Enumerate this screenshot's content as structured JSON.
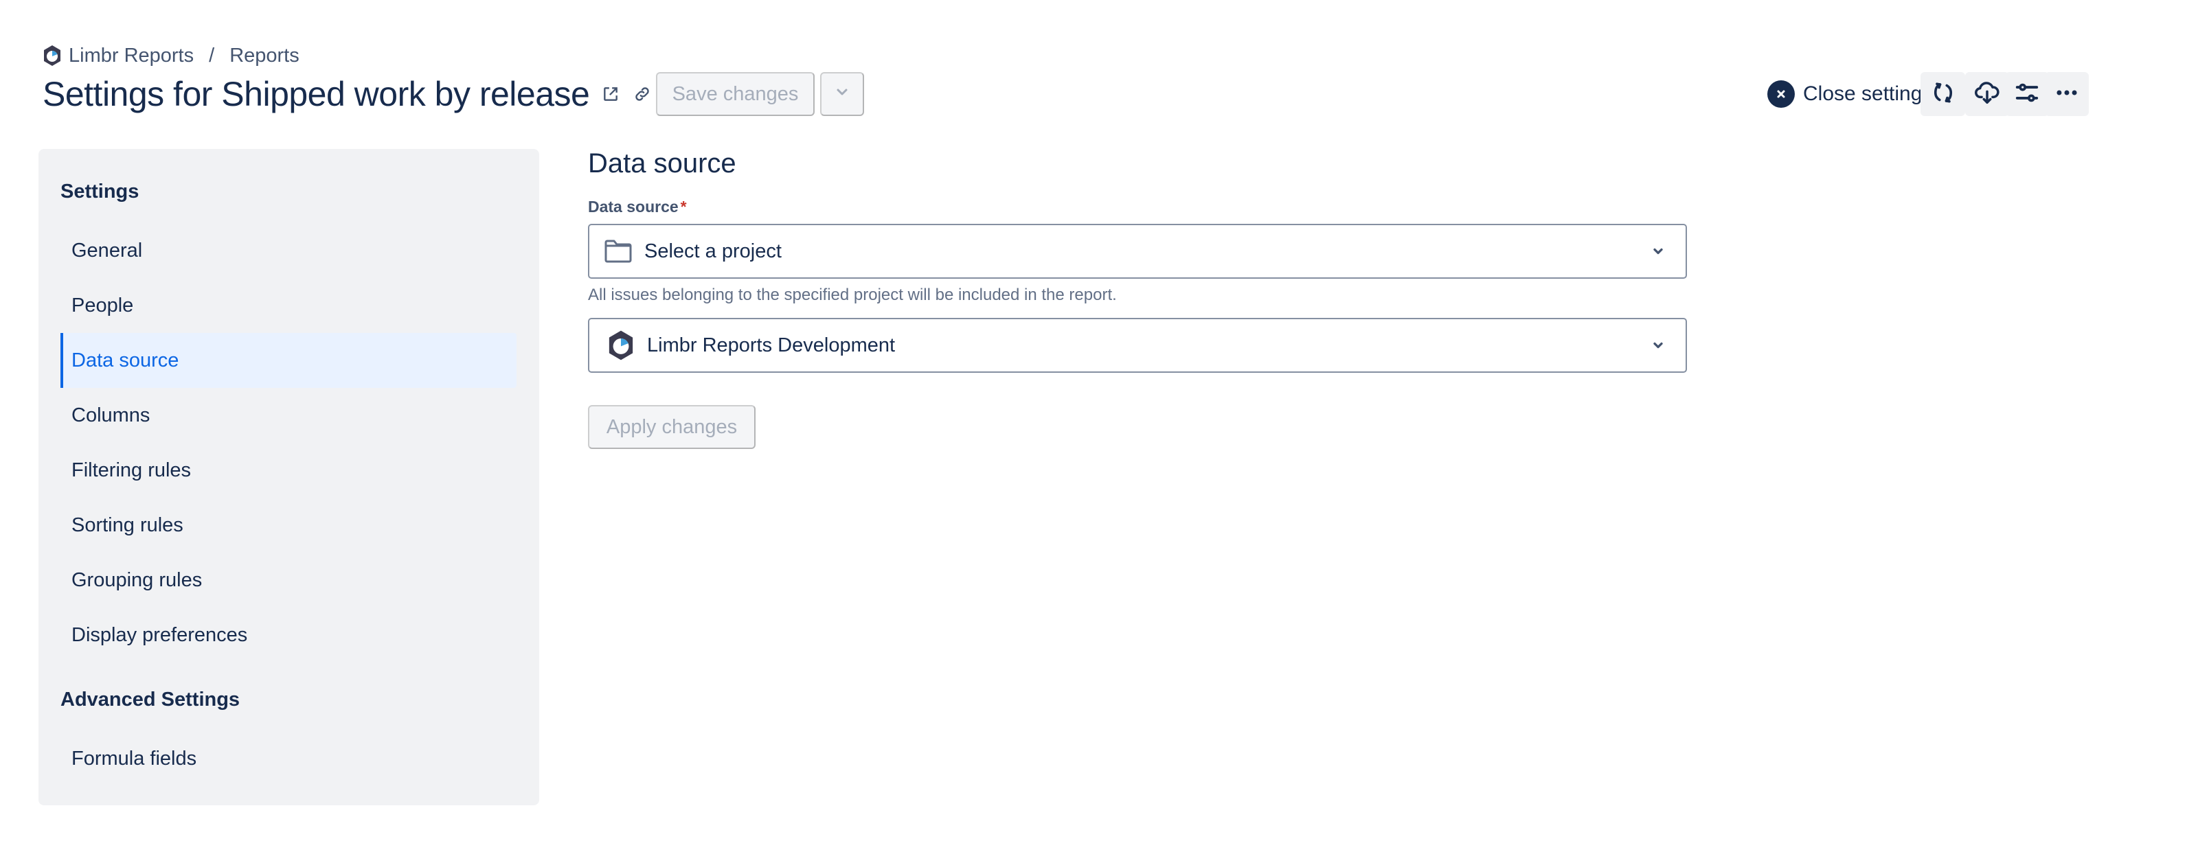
{
  "breadcrumb": {
    "items": [
      "Limbr Reports",
      "Reports"
    ],
    "separator": "/"
  },
  "header": {
    "title": "Settings for Shipped work by release",
    "open_external_icon": "external-link-icon",
    "copy_link_icon": "link-icon",
    "save_label": "Save changes",
    "save_menu_icon": "chevron-down-icon",
    "close_settings_label": "Close settings",
    "toolbar_icons": [
      "refresh-icon",
      "cloud-download-icon",
      "sliders-icon",
      "more-horizontal-icon"
    ]
  },
  "sidebar": {
    "sections": [
      {
        "heading": "Settings",
        "items": [
          "General",
          "People",
          "Data source",
          "Columns",
          "Filtering rules",
          "Sorting rules",
          "Grouping rules",
          "Display preferences"
        ]
      },
      {
        "heading": "Advanced Settings",
        "items": [
          "Formula fields"
        ]
      }
    ],
    "active_item": "Data source"
  },
  "main": {
    "section_title": "Data source",
    "field_label": "Data source",
    "required_marker": "*",
    "project_select": {
      "placeholder": "Select a project",
      "icon": "folder-icon"
    },
    "helper_text": "All issues belonging to the specified project will be included in the report.",
    "source_select": {
      "value": "Limbr Reports Development",
      "icon": "limbr-logo-icon"
    },
    "apply_label": "Apply changes"
  },
  "colors": {
    "text_primary": "#172b4d",
    "accent": "#0c66e4",
    "active_bg": "#e9f2ff",
    "sidebar_bg": "#f1f2f4",
    "required": "#c9372c",
    "logo_dark": "#3b3b4f",
    "logo_accent": "#3f9fdc"
  }
}
